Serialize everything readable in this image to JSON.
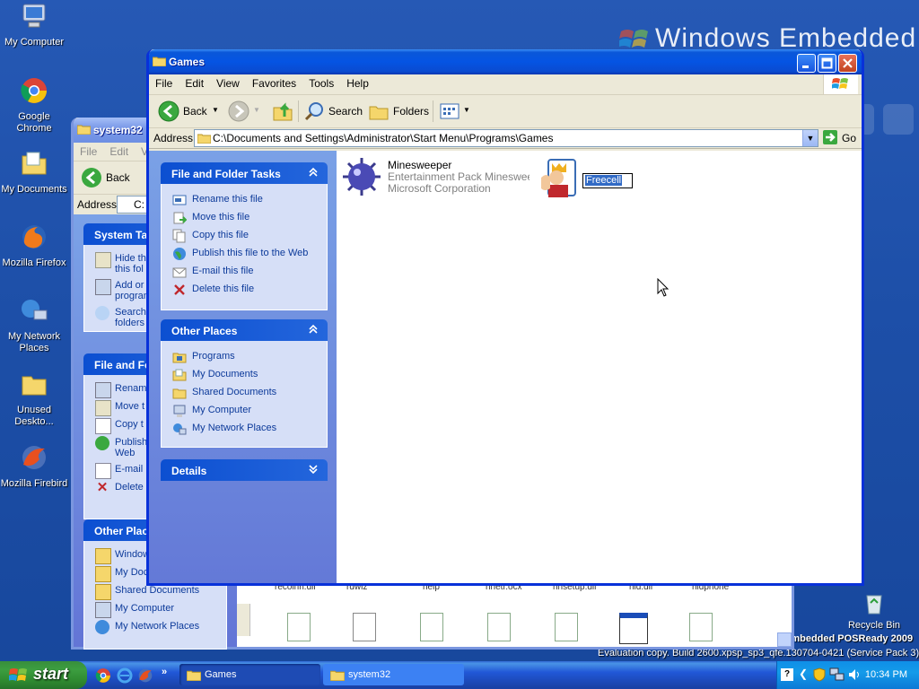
{
  "desktop": {
    "brand_text": "Windows Embedded",
    "posready_text": "Embedded POSReady 2009",
    "eval_text": "Evaluation copy. Build 2600.xpsp_sp3_qfe.130704-0421 (Service Pack 3)",
    "icons": [
      {
        "label": "My Computer"
      },
      {
        "label": "Google Chrome"
      },
      {
        "label": "My Documents"
      },
      {
        "label": "Mozilla Firefox"
      },
      {
        "label": "My Network Places"
      },
      {
        "label": "Unused Deskto..."
      },
      {
        "label": "Mozilla Firebird"
      }
    ],
    "recycle_label": "Recycle Bin"
  },
  "back_window": {
    "title": "system32",
    "menu": [
      "File",
      "Edit",
      "V"
    ],
    "back_label": "Back",
    "address_label": "Address",
    "address_value": "C:",
    "system_tasks_title": "System Ta",
    "system_tasks": [
      "Hide th this fol",
      "Add or program",
      "Search folders"
    ],
    "file_tasks_title": "File and Fo",
    "file_tasks": [
      "Renam",
      "Move t",
      "Copy t",
      "Publish Web",
      "E-mail",
      "Delete"
    ],
    "other_places_title": "Other Plac",
    "other_places": [
      "Window",
      "My Doc",
      "Shared Documents",
      "My Computer",
      "My Network Places"
    ],
    "file_names": [
      "recoinn.dll",
      "rdwiz",
      "help",
      "hnetr.ocx",
      "hnsetup.dll",
      "hid.dll",
      "hidphone"
    ]
  },
  "window": {
    "title": "Games",
    "menu": [
      "File",
      "Edit",
      "View",
      "Favorites",
      "Tools",
      "Help"
    ],
    "toolbar": {
      "back": "Back",
      "search": "Search",
      "folders": "Folders"
    },
    "address_label": "Address",
    "address_value": "C:\\Documents and Settings\\Administrator\\Start Menu\\Programs\\Games",
    "go_label": "Go"
  },
  "tasks": {
    "file_folder": {
      "title": "File and Folder Tasks",
      "items": [
        "Rename this file",
        "Move this file",
        "Copy this file",
        "Publish this file to the Web",
        "E-mail this file",
        "Delete this file"
      ]
    },
    "other_places": {
      "title": "Other Places",
      "items": [
        "Programs",
        "My Documents",
        "Shared Documents",
        "My Computer",
        "My Network Places"
      ]
    },
    "details": {
      "title": "Details"
    }
  },
  "files": [
    {
      "name": "Minesweeper",
      "desc": "Entertainment Pack Minesweeper...",
      "company": "Microsoft Corporation"
    },
    {
      "name": "Freecell",
      "rename_value": "Freecell"
    }
  ],
  "taskbar": {
    "start_label": "start",
    "tasks": [
      "Games",
      "system32"
    ],
    "clock": "10:34 PM"
  },
  "colors": {
    "xp_blue": "#0554e3",
    "task_blue": "#d6dff7",
    "start_green": "#3c9e40"
  }
}
